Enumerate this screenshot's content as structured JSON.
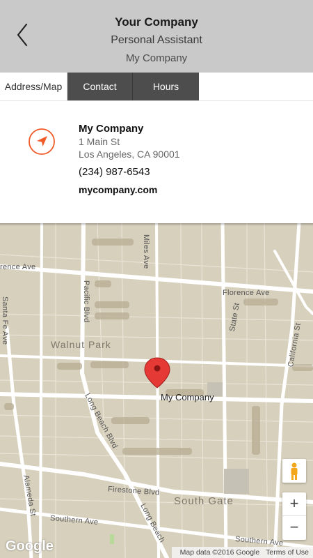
{
  "header": {
    "title": "Your Company",
    "subtitle": "Personal Assistant",
    "company": "My Company",
    "bg_color": "#c9c9c9"
  },
  "tabs": [
    {
      "label": "Address/Map",
      "active": true
    },
    {
      "label": "Contact",
      "active": false
    },
    {
      "label": "Hours",
      "active": false
    }
  ],
  "business": {
    "name": "My Company",
    "address_line1": "1 Main St",
    "address_line2": "Los Angeles, CA 90001",
    "phone": "(234) 987-6543",
    "website": "mycompany.com",
    "icon": "navigation-arrow-icon",
    "accent_color": "#f05a28"
  },
  "map": {
    "streets": {
      "florence_ave_w": "rence Ave",
      "florence_ave_e": "Florence Ave",
      "santa_fe_ave": "Santa Fe Ave",
      "pacific_blvd": "Pacific Blvd",
      "miles_ave": "Miles Ave",
      "state_st": "State St",
      "california_st": "California St",
      "long_beach_blvd": "Long Beach Blvd",
      "long_beach_blvd_2": "Long Beach",
      "alameda_st": "Alameda St",
      "firestone_blvd": "Firestone Blvd",
      "southern_ave": "Southern Ave",
      "southern_ave_e": "Southern Ave"
    },
    "areas": {
      "walnut_park": "Walnut Park",
      "south_gate": "South Gate"
    },
    "marker_label": "My Company",
    "google_logo": "Google",
    "attribution": "Map data ©2016 Google",
    "terms": "Terms of Use",
    "zoom_in": "+",
    "zoom_out": "−"
  }
}
